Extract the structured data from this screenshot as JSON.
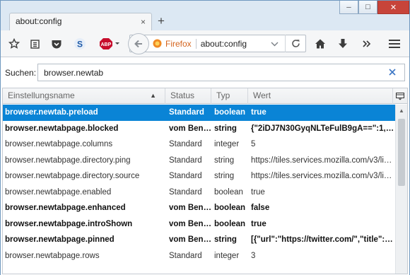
{
  "window": {
    "minimize_glyph": "─",
    "maximize_glyph": "□",
    "close_glyph": "✕"
  },
  "tab": {
    "title": "about:config",
    "close_glyph": "×",
    "new_tab_glyph": "+"
  },
  "navbar": {
    "identity_label": "Firefox",
    "url": "about:config"
  },
  "search": {
    "label": "Suchen:",
    "value": "browser.newtab"
  },
  "table": {
    "columns": [
      "Einstellungsname",
      "Status",
      "Typ",
      "Wert"
    ],
    "rows": [
      {
        "name": "browser.newtab.preload",
        "status": "Standard",
        "type": "boolean",
        "value": "true",
        "style": "sel"
      },
      {
        "name": "browser.newtabpage.blocked",
        "status": "vom Ben…",
        "type": "string",
        "value": "{\"2iDJ7N30GyqNLTeFulB9gA==\":1,\"s…",
        "style": "bold"
      },
      {
        "name": "browser.newtabpage.columns",
        "status": "Standard",
        "type": "integer",
        "value": "5",
        "style": ""
      },
      {
        "name": "browser.newtabpage.directory.ping",
        "status": "Standard",
        "type": "string",
        "value": "https://tiles.services.mozilla.com/v3/lin…",
        "style": ""
      },
      {
        "name": "browser.newtabpage.directory.source",
        "status": "Standard",
        "type": "string",
        "value": "https://tiles.services.mozilla.com/v3/lin…",
        "style": ""
      },
      {
        "name": "browser.newtabpage.enabled",
        "status": "Standard",
        "type": "boolean",
        "value": "true",
        "style": ""
      },
      {
        "name": "browser.newtabpage.enhanced",
        "status": "vom Ben…",
        "type": "boolean",
        "value": "false",
        "style": "bold"
      },
      {
        "name": "browser.newtabpage.introShown",
        "status": "vom Ben…",
        "type": "boolean",
        "value": "true",
        "style": "bold"
      },
      {
        "name": "browser.newtabpage.pinned",
        "status": "vom Ben…",
        "type": "string",
        "value": "[{\"url\":\"https://twitter.com/\",\"title\":…",
        "style": "bold"
      },
      {
        "name": "browser.newtabpage.rows",
        "status": "Standard",
        "type": "integer",
        "value": "3",
        "style": ""
      }
    ]
  },
  "colors": {
    "selection": "#0a84d6",
    "accent": "#3b76c4",
    "close_button": "#c7443a"
  }
}
